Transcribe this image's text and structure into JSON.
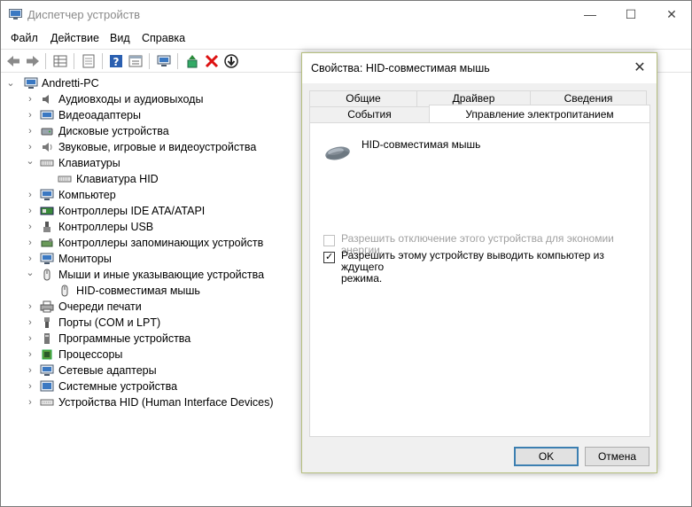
{
  "window": {
    "title": "Диспетчер устройств",
    "controls": {
      "minimize": "—",
      "maximize": "☐",
      "close": "✕"
    }
  },
  "menu": [
    "Файл",
    "Действие",
    "Вид",
    "Справка"
  ],
  "tree": {
    "root": "Andretti-PC",
    "items": [
      {
        "label": "Аудиовходы и аудиовыходы",
        "expanded": false,
        "icon": "audio-icon"
      },
      {
        "label": "Видеоадаптеры",
        "expanded": false,
        "icon": "display-adapter-icon"
      },
      {
        "label": "Дисковые устройства",
        "expanded": false,
        "icon": "disk-icon"
      },
      {
        "label": "Звуковые, игровые и видеоустройства",
        "expanded": false,
        "icon": "sound-icon"
      },
      {
        "label": "Клавиатуры",
        "expanded": true,
        "icon": "keyboard-icon"
      },
      {
        "label": "Клавиатура HID",
        "child": true,
        "icon": "keyboard-icon"
      },
      {
        "label": "Компьютер",
        "expanded": false,
        "icon": "computer-icon"
      },
      {
        "label": "Контроллеры IDE ATA/ATAPI",
        "expanded": false,
        "icon": "ide-icon"
      },
      {
        "label": "Контроллеры USB",
        "expanded": false,
        "icon": "usb-icon"
      },
      {
        "label": "Контроллеры запоминающих устройств",
        "expanded": false,
        "icon": "storage-icon"
      },
      {
        "label": "Мониторы",
        "expanded": false,
        "icon": "monitor-icon"
      },
      {
        "label": "Мыши и иные указывающие устройства",
        "expanded": true,
        "icon": "mouse-icon"
      },
      {
        "label": "HID-совместимая мышь",
        "child": true,
        "icon": "mouse-icon"
      },
      {
        "label": "Очереди печати",
        "expanded": false,
        "icon": "printer-icon"
      },
      {
        "label": "Порты (COM и LPT)",
        "expanded": false,
        "icon": "port-icon"
      },
      {
        "label": "Программные устройства",
        "expanded": false,
        "icon": "software-icon"
      },
      {
        "label": "Процессоры",
        "expanded": false,
        "icon": "cpu-icon"
      },
      {
        "label": "Сетевые адаптеры",
        "expanded": false,
        "icon": "network-icon"
      },
      {
        "label": "Системные устройства",
        "expanded": false,
        "icon": "system-icon"
      },
      {
        "label": "Устройства HID (Human Interface Devices)",
        "expanded": false,
        "icon": "hid-icon"
      }
    ]
  },
  "dialog": {
    "title": "Свойства: HID-совместимая мышь",
    "close": "✕",
    "tabs_row1": [
      "Общие",
      "Драйвер",
      "Сведения"
    ],
    "tabs_row2": [
      "События",
      "Управление электропитанием"
    ],
    "device_name": "HID-совместимая мышь",
    "checkbox1": {
      "label": "Разрешить отключение этого устройства для экономии энергии.",
      "checked": false,
      "enabled": false
    },
    "checkbox2": {
      "label_line1": "Разрешить этому устройству выводить компьютер из ждущего",
      "label_line2": "режима.",
      "checked": true,
      "enabled": true,
      "mark": "✓"
    },
    "ok": "OK",
    "cancel": "Отмена"
  },
  "colors": {
    "accent": "#3c7fb1",
    "dialog_border": "#b6bf7e"
  }
}
